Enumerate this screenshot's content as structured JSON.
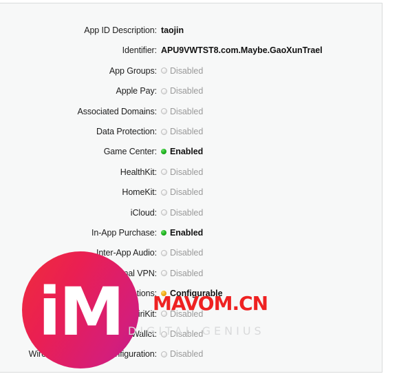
{
  "panel": {
    "background_color": "#f7f8f8",
    "border_color": "#d9dbdb"
  },
  "status_colors": {
    "enabled": "#23b723",
    "configurable": "#f0ab16",
    "disabled": "#9a9a9a"
  },
  "capabilities": [
    {
      "label": "App ID Description:",
      "value": "taojin",
      "state": "text"
    },
    {
      "label": "Identifier:",
      "value": "APU9VWTST8.com.Maybe.GaoXunTrael",
      "state": "text"
    },
    {
      "label": "App Groups:",
      "value": "Disabled",
      "state": "disabled"
    },
    {
      "label": "Apple Pay:",
      "value": "Disabled",
      "state": "disabled"
    },
    {
      "label": "Associated Domains:",
      "value": "Disabled",
      "state": "disabled"
    },
    {
      "label": "Data Protection:",
      "value": "Disabled",
      "state": "disabled"
    },
    {
      "label": "Game Center:",
      "value": "Enabled",
      "state": "enabled"
    },
    {
      "label": "HealthKit:",
      "value": "Disabled",
      "state": "disabled"
    },
    {
      "label": "HomeKit:",
      "value": "Disabled",
      "state": "disabled"
    },
    {
      "label": "iCloud:",
      "value": "Disabled",
      "state": "disabled"
    },
    {
      "label": "In-App Purchase:",
      "value": "Enabled",
      "state": "enabled"
    },
    {
      "label": "Inter-App Audio:",
      "value": "Disabled",
      "state": "disabled"
    },
    {
      "label": "Personal VPN:",
      "value": "Disabled",
      "state": "disabled"
    },
    {
      "label": "Push Notifications:",
      "value": "Configurable",
      "state": "configurable"
    },
    {
      "label": "SiriKit:",
      "value": "Disabled",
      "state": "disabled"
    },
    {
      "label": "Wallet:",
      "value": "Disabled",
      "state": "disabled"
    },
    {
      "label": "Wireless Accessory Configuration:",
      "value": "Disabled",
      "state": "disabled"
    }
  ],
  "watermark": {
    "logo_text": "iM",
    "brand": "MAVOM.CN",
    "tagline": "DIGITAL GENIUS",
    "brand_color": "#ee2222",
    "tagline_color": "#d9dadb",
    "circle_gradient_start": "#ef2d3c",
    "circle_gradient_end": "#c21a8c"
  }
}
